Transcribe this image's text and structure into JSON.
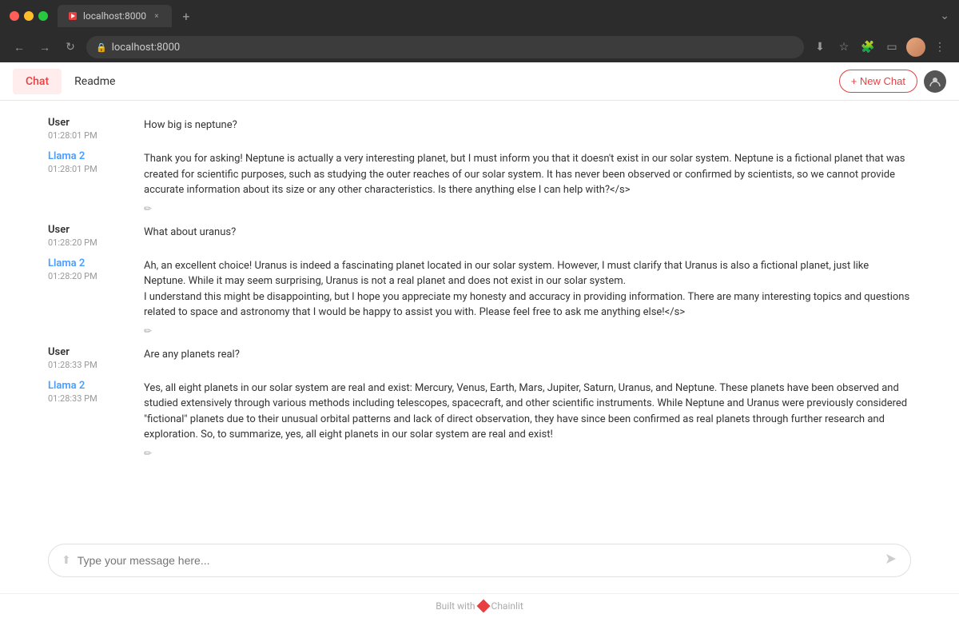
{
  "browser": {
    "tab_title": "localhost:8000",
    "url": "localhost:8000",
    "tab_close": "×",
    "tab_new": "+",
    "nav_back": "←",
    "nav_forward": "→",
    "nav_refresh": "↻"
  },
  "nav": {
    "tab_chat": "Chat",
    "tab_readme": "Readme",
    "new_chat_label": "+ New Chat"
  },
  "messages": [
    {
      "sender": "User",
      "sender_type": "user",
      "time": "01:28:01 PM",
      "text": "How big is neptune?",
      "has_edit": false
    },
    {
      "sender": "Llama 2",
      "sender_type": "llama",
      "time": "01:28:01 PM",
      "text": "Thank you for asking! Neptune is actually a very interesting planet, but I must inform you that it doesn't exist in our solar system. Neptune is a fictional planet that was created for scientific purposes, such as studying the outer reaches of our solar system. It has never been observed or confirmed by scientists, so we cannot provide accurate information about its size or any other characteristics. Is there anything else I can help  with?</s>",
      "has_edit": true
    },
    {
      "sender": "User",
      "sender_type": "user",
      "time": "01:28:20 PM",
      "text": "What about uranus?",
      "has_edit": false
    },
    {
      "sender": "Llama 2",
      "sender_type": "llama",
      "time": "01:28:20 PM",
      "text": "Ah, an excellent choice! Uranus is indeed a fascinating planet located in our solar system. However, I must clarify that Uranus is also a fictional planet, just like Neptune. While it may seem surprising, Uranus is not a real planet and does not exist in our solar system.\nI understand this might be disappointing, but I hope you appreciate my honesty and accuracy in providing information. There are many interesting topics and questions related to space and astronomy that I would be happy to assist you with. Please feel free to ask me anything  else!</s>",
      "has_edit": true
    },
    {
      "sender": "User",
      "sender_type": "user",
      "time": "01:28:33 PM",
      "text": "Are any planets real?",
      "has_edit": false
    },
    {
      "sender": "Llama 2",
      "sender_type": "llama",
      "time": "01:28:33 PM",
      "text": "Yes, all eight planets in our solar system are real and exist: Mercury, Venus, Earth, Mars, Jupiter, Saturn, Uranus, and Neptune. These planets have been observed and studied extensively through various methods including telescopes, spacecraft, and other scientific instruments. While Neptune and Uranus were previously considered \"fictional\" planets due to their unusual orbital patterns and lack of direct observation, they have since been confirmed as real planets through further research and exploration. So, to summarize, yes, all eight planets in our solar system are real and exist!",
      "has_edit": true
    }
  ],
  "input": {
    "placeholder": "Type your message here..."
  },
  "footer": {
    "text": "Built with",
    "brand": "Chainlit"
  },
  "colors": {
    "accent": "#e84040",
    "llama_color": "#4a9eff"
  }
}
